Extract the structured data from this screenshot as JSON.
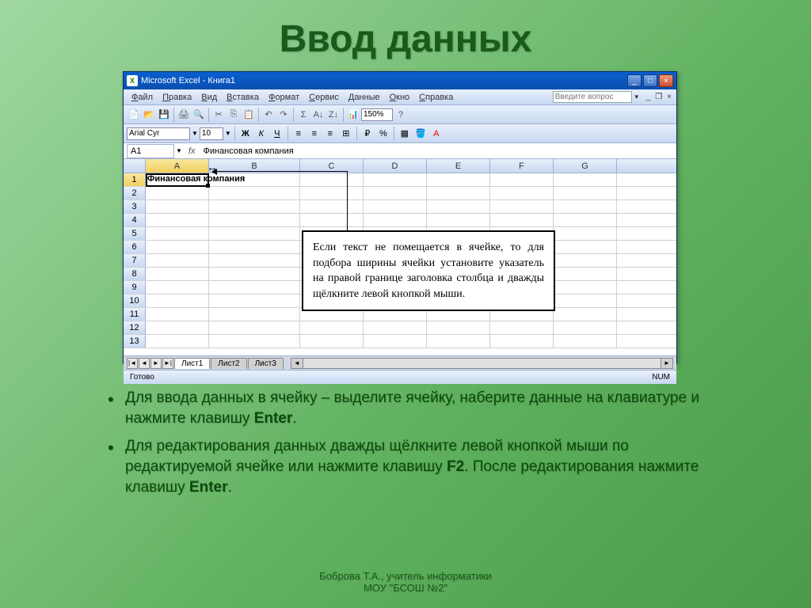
{
  "slide": {
    "title": "Ввод данных",
    "bullet1_a": "Для ввода данных в ячейку – выделите ячейку, наберите данные на клавиатуре и нажмите клавишу ",
    "bullet1_b": "Enter",
    "bullet1_c": ".",
    "bullet2_a": "Для редактирования данных дважды щёлкните левой кнопкой мыши по редактируемой ячейке или нажмите клавишу ",
    "bullet2_b": "F2",
    "bullet2_c": ". После редактирования нажмите клавишу ",
    "bullet2_d": "Enter",
    "bullet2_e": ".",
    "footer1": "Боброва Т.А., учитель информатики",
    "footer2": "МОУ \"БСОШ №2\""
  },
  "excel": {
    "title": "Microsoft Excel - Книга1",
    "app_icon": "X",
    "menu": [
      "Файл",
      "Правка",
      "Вид",
      "Вставка",
      "Формат",
      "Сервис",
      "Данные",
      "Окно",
      "Справка"
    ],
    "help_placeholder": "Введите вопрос",
    "zoom": "150%",
    "font_name": "Arial Cyr",
    "font_size": "10",
    "name_box": "A1",
    "fx": "fx",
    "formula_value": "Финансовая компания",
    "columns": [
      "A",
      "B",
      "C",
      "D",
      "E",
      "F",
      "G"
    ],
    "row_count": 13,
    "cell_a1": "Финансовая компания",
    "callout": "Если текст не помещается в ячейке, то для подбора ширины ячейки установите указатель на правой границе заголовка столбца и дважды щёлкните левой кнопкой мыши.",
    "tabs": [
      "Лист1",
      "Лист2",
      "Лист3"
    ],
    "status": "Готово",
    "status_num": "NUM"
  },
  "icons": {
    "min": "_",
    "max": "□",
    "close": "×",
    "doc_min": "_",
    "doc_restore": "❐",
    "doc_close": "×",
    "resize": "↔"
  }
}
